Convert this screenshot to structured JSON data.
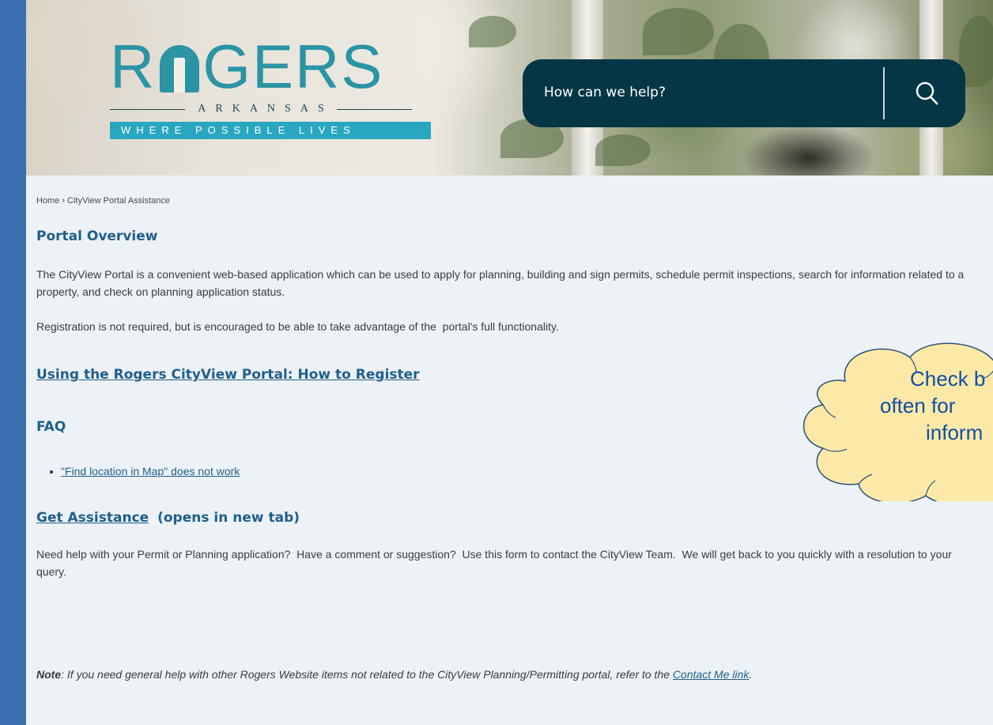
{
  "header": {
    "logo": {
      "word_left": "R",
      "word_right": "GERS",
      "state": "ARKANSAS",
      "tagline": "WHERE POSSIBLE LIVES"
    },
    "search": {
      "placeholder": "How can we help?",
      "icon": "search-icon"
    }
  },
  "breadcrumb": {
    "home": "Home",
    "separator": "›",
    "current": "CityView Portal Assistance"
  },
  "overview": {
    "heading": "Portal Overview",
    "paragraph1": "The CityView Portal is a convenient web-based application which can be used to apply for planning, building and sign permits, schedule permit inspections, search for information related to a property, and check on planning application status.",
    "paragraph2": "Registration is not required, but is encouraged to be able to take advantage of the  portal's full functionality."
  },
  "register_link": "Using the Rogers CityView Portal: How to Register",
  "faq": {
    "heading": "FAQ",
    "items": [
      "\"Find location in Map\" does not work"
    ]
  },
  "assistance": {
    "link": "Get Assistance",
    "suffix": "(opens in new tab)",
    "paragraph": "Need help with your Permit or Planning application?  Have a comment or suggestion?  Use this form to contact the CityView Team.  We will get back to you quickly with a resolution to your query."
  },
  "note": {
    "label": "Note",
    "text": ": If you need general help with other Rogers Website items not related to the CityView Planning/Permitting portal, refer to the ",
    "link": "Contact Me link",
    "end": "."
  },
  "callout": {
    "lines": [
      "Check b",
      "often for",
      "inform"
    ]
  },
  "colors": {
    "frame_border": "#3a70b0",
    "heading": "#1f5f8b",
    "search_bg": "#053646",
    "logo_teal": "#2b94a5",
    "callout_fill": "#fde9a7"
  }
}
